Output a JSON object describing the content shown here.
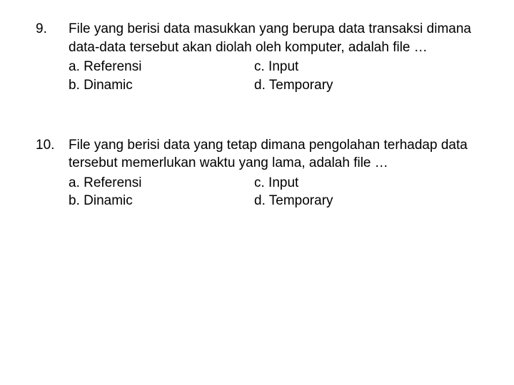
{
  "questions": [
    {
      "number": "9.",
      "stem": "File yang berisi data masukkan yang berupa data transaksi dimana data-data tersebut akan diolah oleh komputer, adalah file …",
      "options": {
        "a": "a. Referensi",
        "b": "b. Dinamic",
        "c": "c. Input",
        "d": "d. Temporary"
      }
    },
    {
      "number": "10.",
      "stem": "File yang berisi data yang tetap dimana pengolahan terhadap data tersebut memerlukan waktu yang lama, adalah file …",
      "options": {
        "a": "a. Referensi",
        "b": "b. Dinamic",
        "c": "c. Input",
        "d": "d. Temporary"
      }
    }
  ]
}
